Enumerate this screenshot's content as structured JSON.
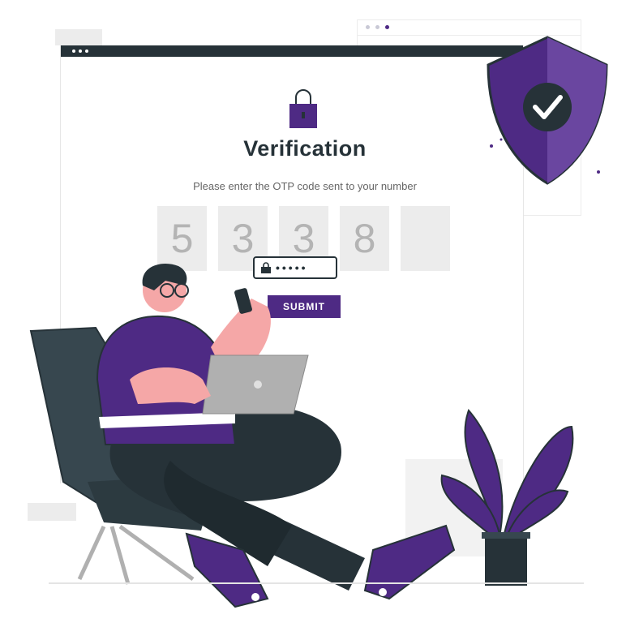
{
  "verification": {
    "title": "Verification",
    "instruction": "Please enter the OTP code sent to your number",
    "otp_digits": [
      "5",
      "3",
      "3",
      "8",
      ""
    ],
    "submit_label": "SUBMIT",
    "password_mask": "•••••"
  },
  "colors": {
    "accent": "#4e2a84",
    "dark": "#263238",
    "box": "#ececec",
    "skin": "#f5a7a7"
  },
  "icons": [
    "padlock-icon",
    "shield-check-icon",
    "lock-icon"
  ]
}
